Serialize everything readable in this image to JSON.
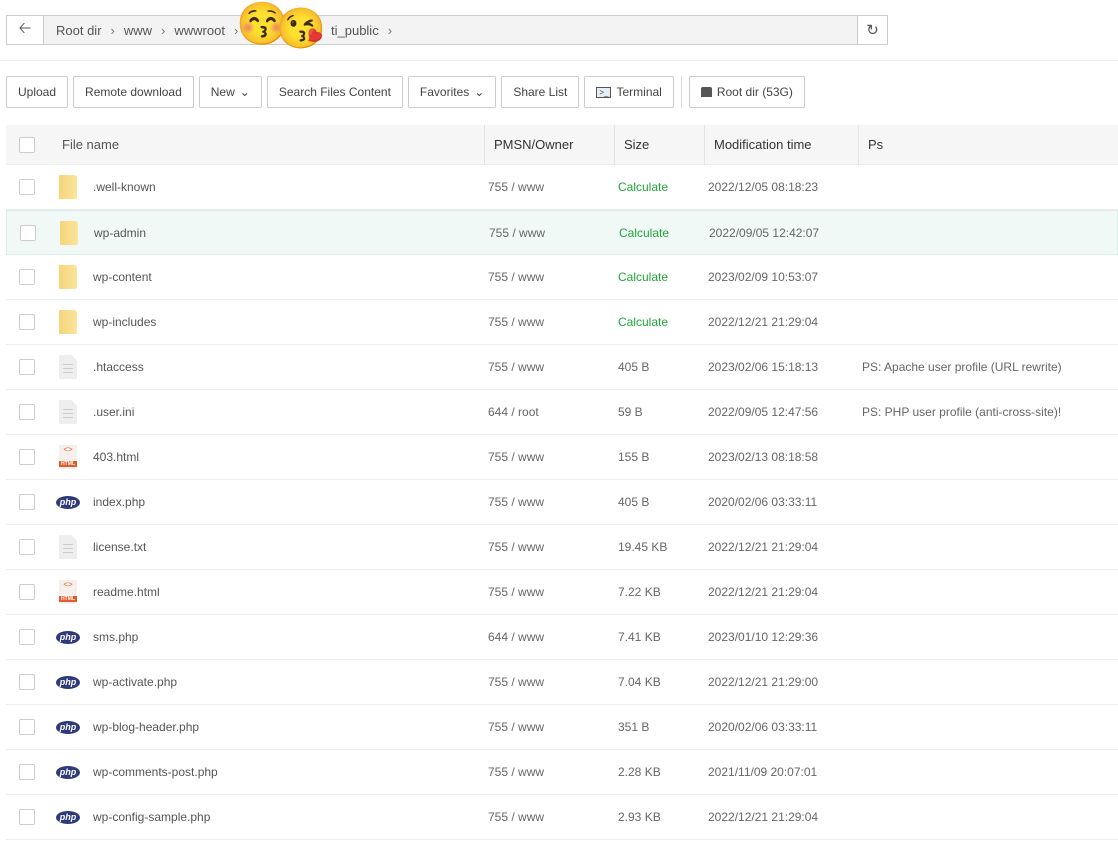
{
  "breadcrumb": [
    "Root dir",
    "www",
    "wwwroot",
    "r",
    "ti_public"
  ],
  "toolbar": {
    "upload": "Upload",
    "remote": "Remote download",
    "new": "New",
    "search": "Search Files Content",
    "favorites": "Favorites",
    "share": "Share List",
    "terminal": "Terminal",
    "rootdir": "Root dir (53G)"
  },
  "columns": {
    "name": "File name",
    "perm": "PMSN/Owner",
    "size": "Size",
    "time": "Modification time",
    "ps": "Ps"
  },
  "rows": [
    {
      "type": "folder",
      "name": ".well-known",
      "perm": "755 / www",
      "size": "Calculate",
      "time": "2022/12/05 08:18:23",
      "ps": ""
    },
    {
      "type": "folder",
      "name": "wp-admin",
      "perm": "755 / www",
      "size": "Calculate",
      "time": "2022/09/05 12:42:07",
      "ps": ""
    },
    {
      "type": "folder",
      "name": "wp-content",
      "perm": "755 / www",
      "size": "Calculate",
      "time": "2023/02/09 10:53:07",
      "ps": ""
    },
    {
      "type": "folder",
      "name": "wp-includes",
      "perm": "755 / www",
      "size": "Calculate",
      "time": "2022/12/21 21:29:04",
      "ps": ""
    },
    {
      "type": "file",
      "name": ".htaccess",
      "perm": "755 / www",
      "size": "405 B",
      "time": "2023/02/06 15:18:13",
      "ps": "PS: Apache user profile (URL rewrite)"
    },
    {
      "type": "file",
      "name": ".user.ini",
      "perm": "644 / root",
      "size": "59 B",
      "time": "2022/09/05 12:47:56",
      "ps": "PS: PHP user profile (anti-cross-site)!"
    },
    {
      "type": "html",
      "name": "403.html",
      "perm": "755 / www",
      "size": "155 B",
      "time": "2023/02/13 08:18:58",
      "ps": ""
    },
    {
      "type": "php",
      "name": "index.php",
      "perm": "755 / www",
      "size": "405 B",
      "time": "2020/02/06 03:33:11",
      "ps": ""
    },
    {
      "type": "file",
      "name": "license.txt",
      "perm": "755 / www",
      "size": "19.45 KB",
      "time": "2022/12/21 21:29:04",
      "ps": ""
    },
    {
      "type": "html",
      "name": "readme.html",
      "perm": "755 / www",
      "size": "7.22 KB",
      "time": "2022/12/21 21:29:04",
      "ps": ""
    },
    {
      "type": "php",
      "name": "sms.php",
      "perm": "644 / www",
      "size": "7.41 KB",
      "time": "2023/01/10 12:29:36",
      "ps": ""
    },
    {
      "type": "php",
      "name": "wp-activate.php",
      "perm": "755 / www",
      "size": "7.04 KB",
      "time": "2022/12/21 21:29:00",
      "ps": ""
    },
    {
      "type": "php",
      "name": "wp-blog-header.php",
      "perm": "755 / www",
      "size": "351 B",
      "time": "2020/02/06 03:33:11",
      "ps": ""
    },
    {
      "type": "php",
      "name": "wp-comments-post.php",
      "perm": "755 / www",
      "size": "2.28 KB",
      "time": "2021/11/09 20:07:01",
      "ps": ""
    },
    {
      "type": "php",
      "name": "wp-config-sample.php",
      "perm": "755 / www",
      "size": "2.93 KB",
      "time": "2022/12/21 21:29:04",
      "ps": ""
    }
  ],
  "icons": {
    "html_label": "HTML",
    "php_label": "php"
  }
}
